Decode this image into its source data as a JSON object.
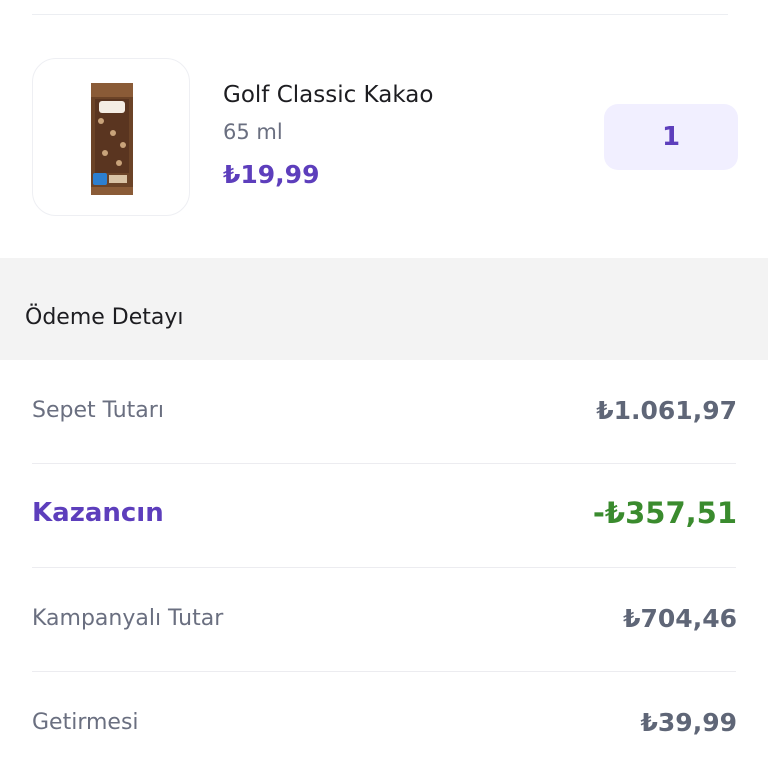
{
  "product": {
    "name": "Golf Classic Kakao",
    "size": "65 ml",
    "price": "₺19,99",
    "quantity": "1",
    "image_icon": "ice-cream-bar-icon"
  },
  "payment_details": {
    "title": "Ödeme Detayı",
    "rows": [
      {
        "label": "Sepet Tutarı",
        "value": "₺1.061,97"
      },
      {
        "label": "Kazancın",
        "value": "-₺357,51"
      },
      {
        "label": "Kampanyalı Tutar",
        "value": "₺704,46"
      },
      {
        "label": "Getirmesi",
        "value": "₺39,99"
      }
    ]
  },
  "colors": {
    "brand_purple": "#5d3ebc",
    "savings_green": "#3a8b2e",
    "qty_background": "#f1efff",
    "section_background": "#f3f3f3"
  }
}
